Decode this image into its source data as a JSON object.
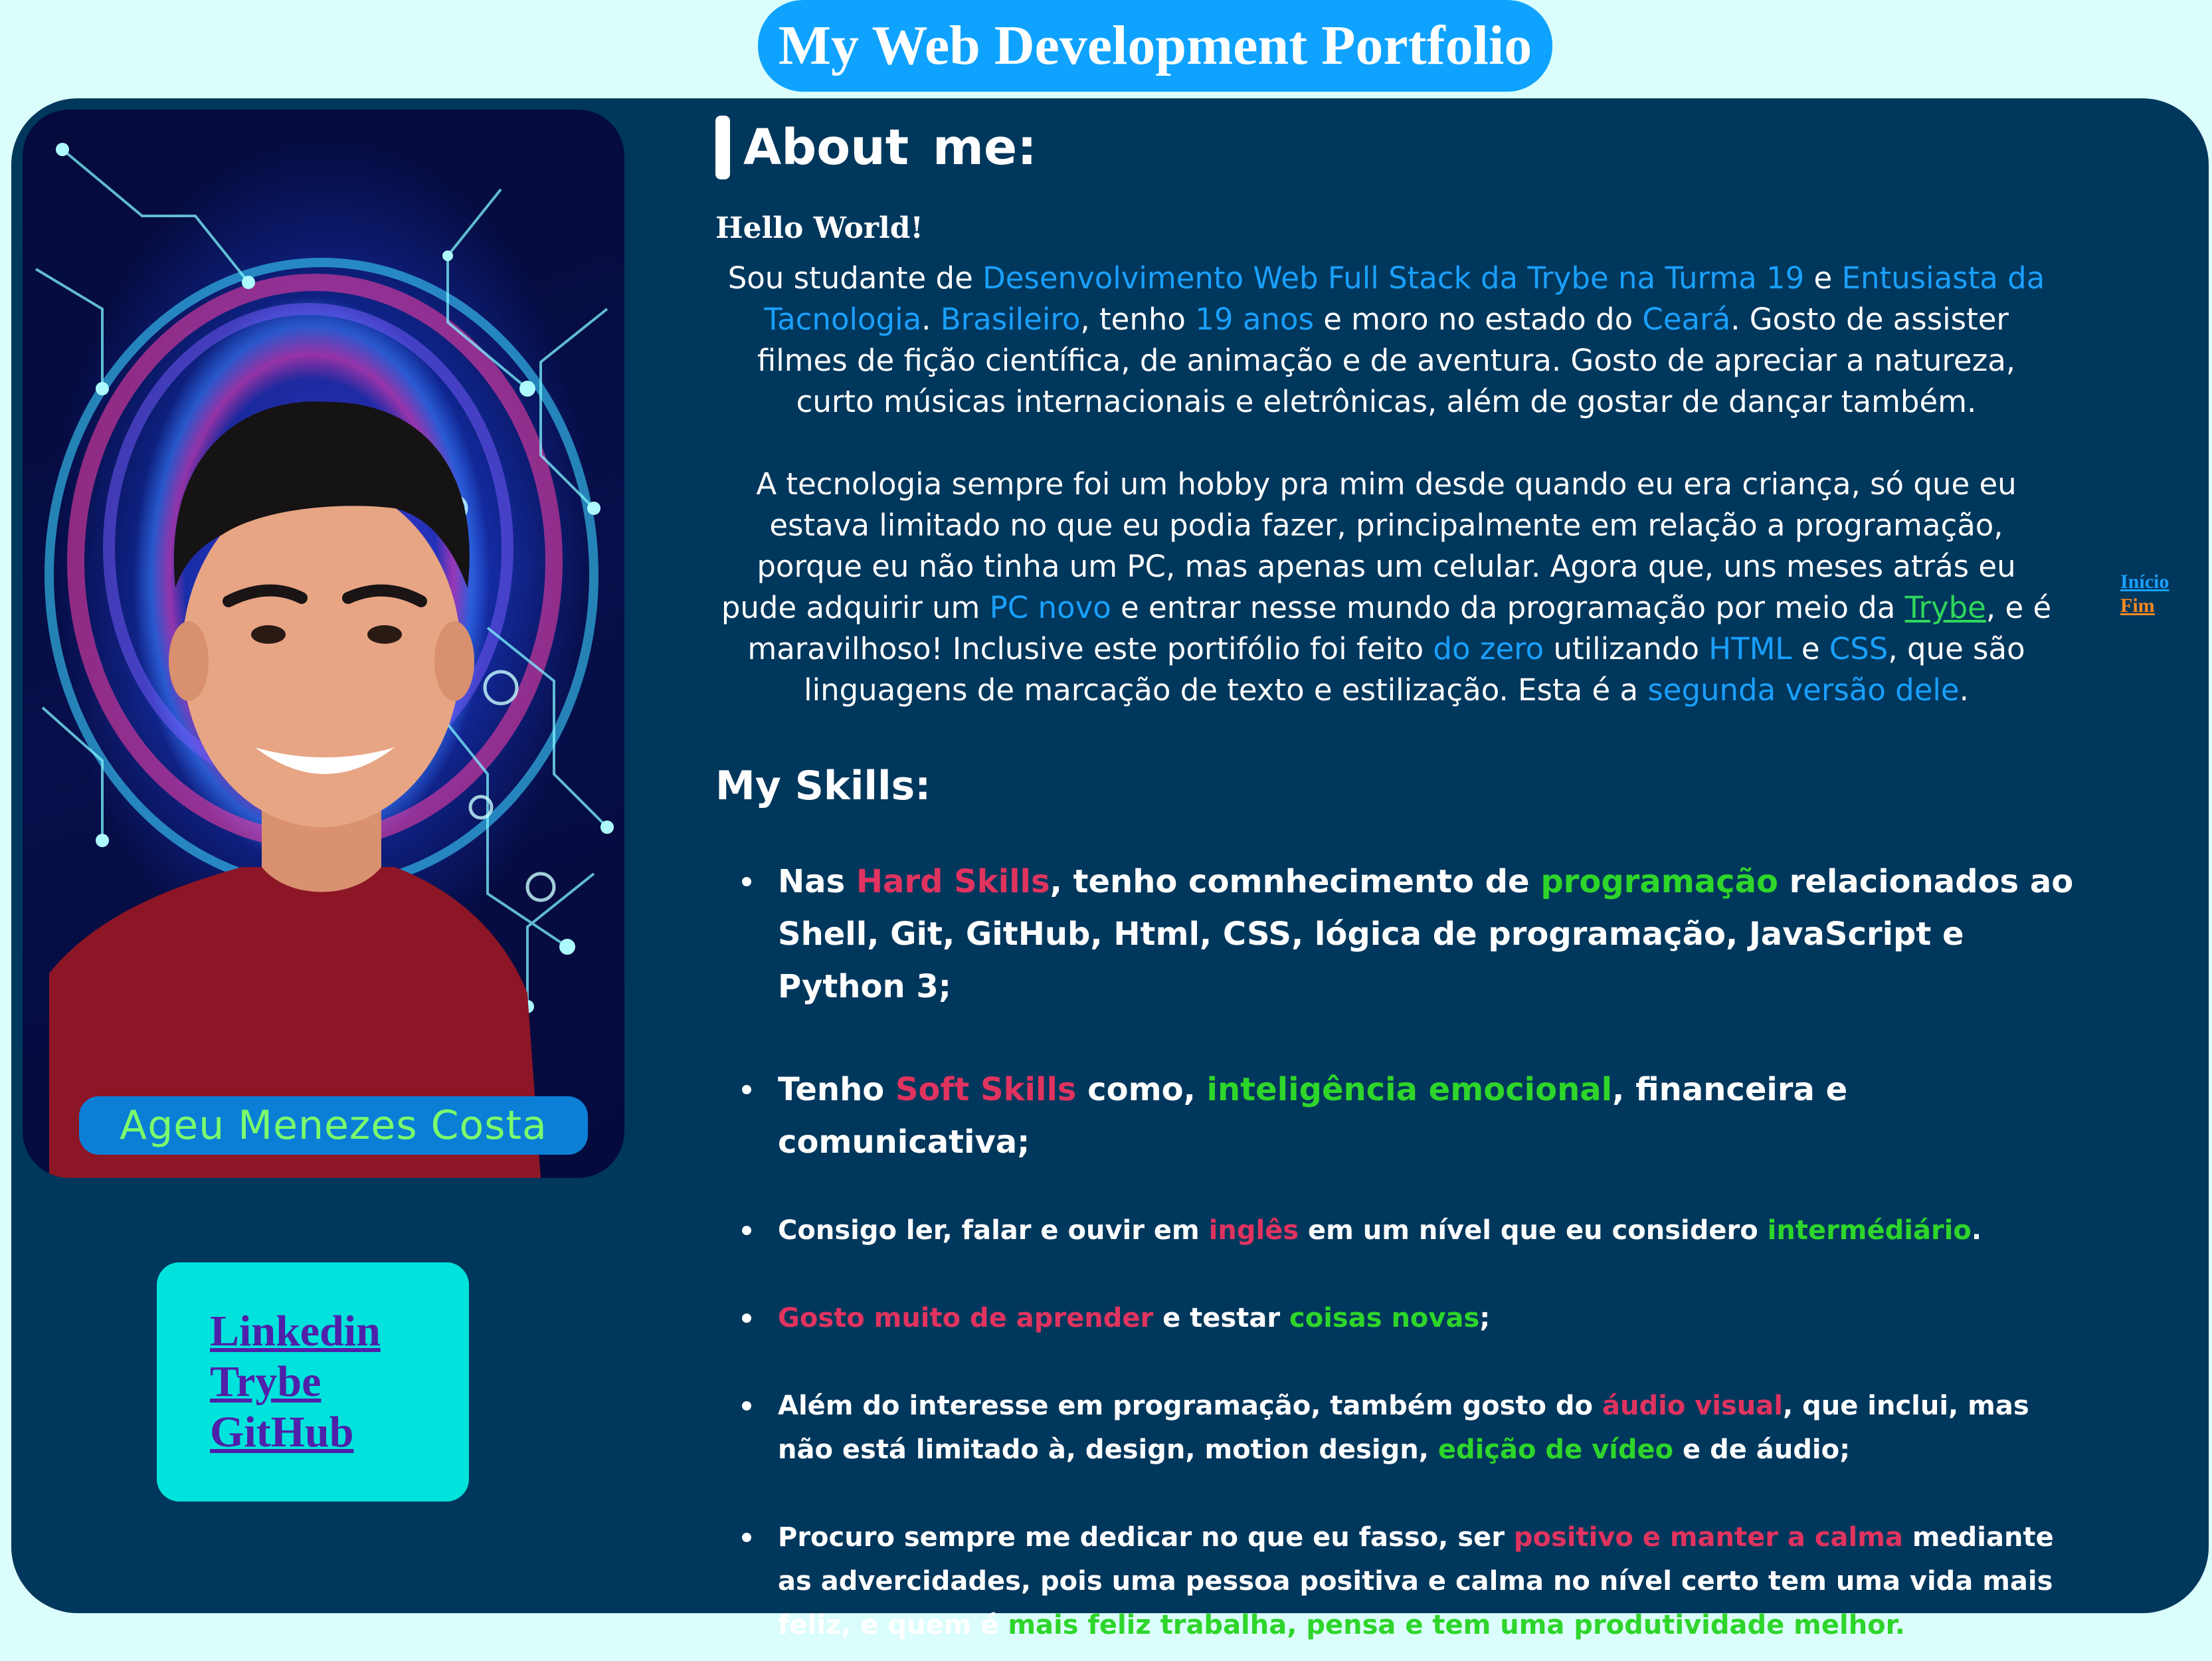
{
  "header": {
    "title": "My Web Development Portfolio"
  },
  "profile": {
    "name": "Ageu Menezes Costa"
  },
  "links": [
    {
      "label": "Linkedin"
    },
    {
      "label": "Trybe"
    },
    {
      "label": "GitHub"
    }
  ],
  "about": {
    "heading": "About me:",
    "greeting": "Hello World!",
    "p1": [
      "Sou studante de ",
      "Desenvolvimento Web Full Stack da Trybe na Turma 19",
      " e ",
      "Entusiasta da Tacnologia",
      ". ",
      "Brasileiro",
      ", tenho ",
      "19 anos",
      " e moro no estado do ",
      "Ceará",
      ". Gosto de assister filmes de fição científica, de animação e de aventura. Gosto de apreciar a natureza, curto músicas internacionais e eletrônicas, além de gostar de dançar também."
    ],
    "p2": [
      "A tecnologia sempre foi um hobby pra mim desde quando eu era criança, só que eu estava limitado no que eu podia fazer, principalmente em relação a programação, porque eu não tinha um PC, mas apenas um celular. Agora que, uns meses atrás eu pude adquirir um ",
      "PC novo",
      " e entrar nesse mundo da programação por meio da ",
      "Trybe",
      ", e é maravilhoso! Inclusive este portifólio foi feito ",
      "do zero",
      " utilizando ",
      "HTML",
      " e ",
      "CSS",
      ", que são linguagens de marcação de texto e estilização. Esta é a ",
      "segunda versão dele",
      "."
    ]
  },
  "skills": {
    "heading": "My Skills:",
    "items": [
      [
        "Nas ",
        "Hard Skills",
        ", tenho comnhecimento de ",
        "programação",
        " relacionados ao Shell, Git, GitHub, Html, CSS, lógica de programação, JavaScript e Python 3;"
      ],
      [
        "Tenho ",
        "Soft Skills",
        " como, ",
        "inteligência emocional",
        ", financeira e comunicativa;"
      ],
      [
        "Consigo ler, falar e ouvir em ",
        "inglês",
        " em um nível que eu considero ",
        "intermédiário",
        "."
      ],
      [
        "Gosto muito de aprender",
        " e testar ",
        "coisas novas",
        ";"
      ],
      [
        "Além do interesse em programação, também gosto do ",
        "áudio visual",
        ", que inclui, mas não está limitado à, design, motion design, ",
        "edição de vídeo",
        " e de áudio;"
      ],
      [
        "Procuro sempre me dedicar no que eu fasso, ser ",
        "positivo e manter a calma",
        " mediante as advercidades, pois uma pessoa positiva e calma no nível certo tem uma vida mais feliz, e quem é ",
        "mais feliz trabalha, pensa e tem uma produtividade melhor."
      ]
    ]
  },
  "side_nav": {
    "start_label": "Início",
    "end_label": "Fim"
  },
  "colors": {
    "background": "#dbfdfc",
    "panel": "#00375c",
    "title_bg": "#0fa3ff",
    "links_bg": "#00e2dc",
    "highlight_blue": "#1aa0ff",
    "highlight_pink": "#e0335f",
    "highlight_green": "#2ed52a",
    "name_text": "#7cff6b",
    "nav_end": "#ff8a1f"
  }
}
